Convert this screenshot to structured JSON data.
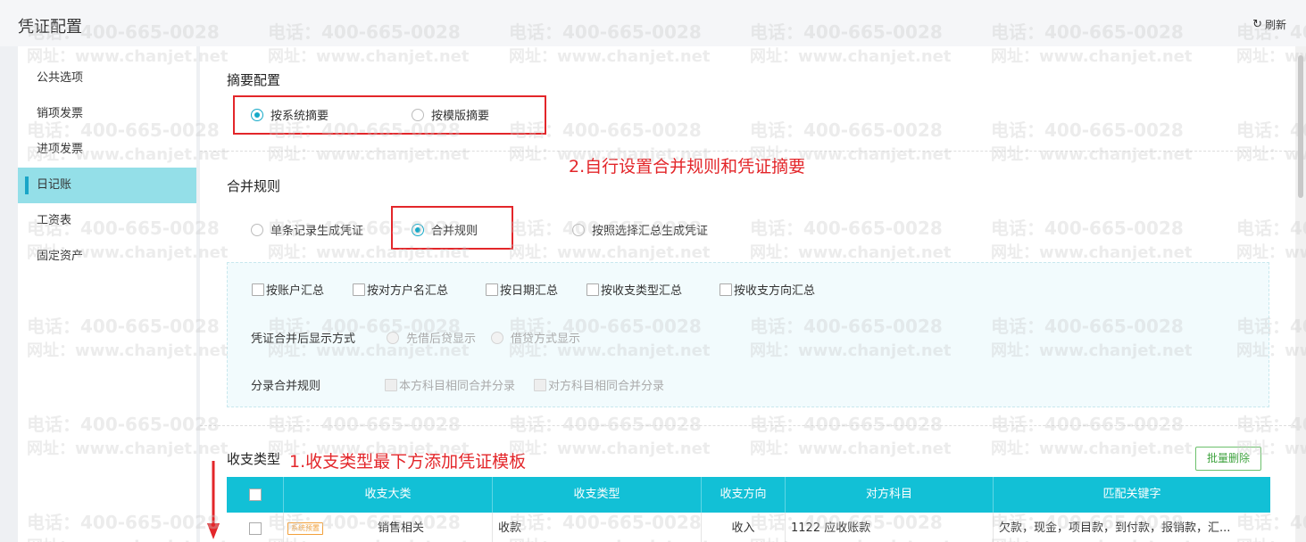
{
  "header": {
    "title": "凭证配置",
    "refresh_label": "刷新"
  },
  "sidebar": {
    "items": [
      {
        "label": "公共选项",
        "active": false
      },
      {
        "label": "销项发票",
        "active": false
      },
      {
        "label": "进项发票",
        "active": false
      },
      {
        "label": "日记账",
        "active": true
      },
      {
        "label": "工资表",
        "active": false
      },
      {
        "label": "固定资产",
        "active": false
      }
    ]
  },
  "summary": {
    "title": "摘要配置",
    "options": [
      {
        "label": "按系统摘要",
        "selected": true
      },
      {
        "label": "按模版摘要",
        "selected": false
      }
    ]
  },
  "merge": {
    "title": "合并规则",
    "options": [
      {
        "label": "单条记录生成凭证",
        "selected": false
      },
      {
        "label": "合并规则",
        "selected": true
      },
      {
        "label": "按照选择汇总生成凭证",
        "selected": false
      }
    ],
    "checks": [
      "按账户汇总",
      "按对方户名汇总",
      "按日期汇总",
      "按收支类型汇总",
      "按收支方向汇总"
    ],
    "display_label": "凭证合并后显示方式",
    "display_options": [
      "先借后贷显示",
      "借贷方式显示"
    ],
    "entry_label": "分录合并规则",
    "entry_options": [
      "本方科目相同合并分录",
      "对方科目相同合并分录"
    ]
  },
  "annotations": {
    "a2": "2.自行设置合并规则和凭证摘要",
    "a1": "1.收支类型最下方添加凭证模板"
  },
  "types": {
    "title": "收支类型",
    "batch_delete": "批量删除",
    "columns": [
      "收支大类",
      "收支类型",
      "收支方向",
      "对方科目",
      "匹配关键字"
    ],
    "rows": [
      {
        "tag": "系统预置",
        "category": "销售相关",
        "type": "收款",
        "direction": "收入",
        "account": "1122 应收账款",
        "keywords": "欠款，现金，项目款，到付款，报销款，汇..."
      }
    ]
  },
  "watermark": {
    "phone": "电话：400-665-0028",
    "site": "网址：www.chanjet.net"
  },
  "colors": {
    "accent": "#12c0d6",
    "annotation": "#e3262a",
    "active_bg": "#94dfe8"
  }
}
